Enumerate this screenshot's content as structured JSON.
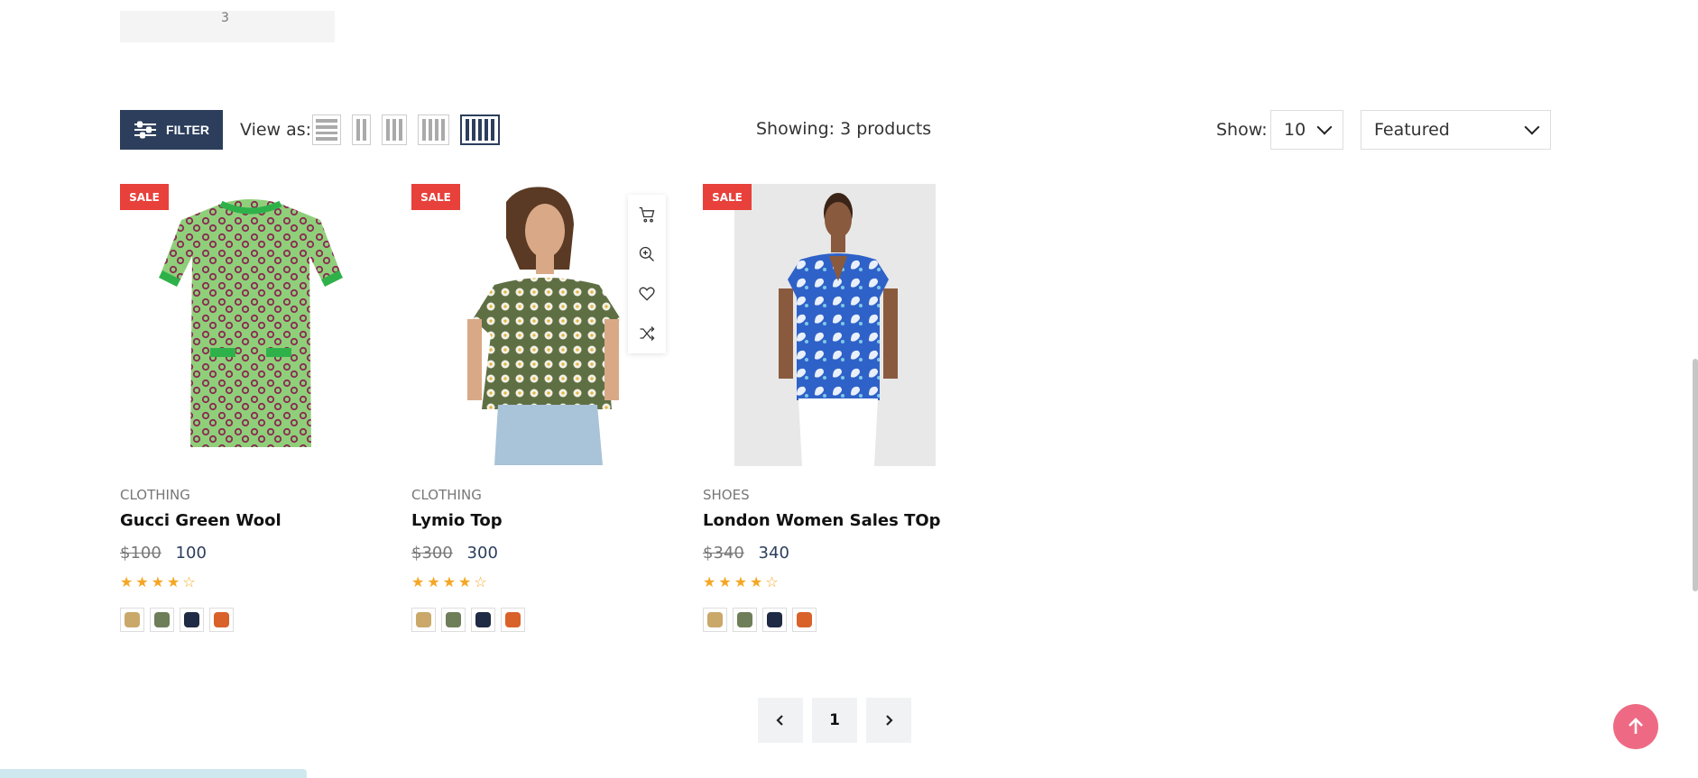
{
  "top_box": {
    "number": "3"
  },
  "toolbar": {
    "filter_label": "FILTER",
    "view_as_label": "View as:",
    "showing_text": "Showing: 3 products",
    "show_label": "Show:",
    "per_page_value": "10",
    "sort_value": "Featured",
    "active_view": "5-column"
  },
  "products": [
    {
      "badge": "SALE",
      "category": "CLOTHING",
      "title": "Gucci Green Wool",
      "old_price": "$100",
      "price": "100",
      "rating": 4,
      "stars": "★★★★☆",
      "swatches": [
        "#c9a86a",
        "#6e7e58",
        "#1f2a44",
        "#d9612a"
      ]
    },
    {
      "badge": "SALE",
      "category": "CLOTHING",
      "title": "Lymio Top",
      "old_price": "$300",
      "price": "300",
      "rating": 4,
      "stars": "★★★★☆",
      "swatches": [
        "#c9a86a",
        "#6e7e58",
        "#1f2a44",
        "#d9612a"
      ]
    },
    {
      "badge": "SALE",
      "category": "SHOES",
      "title": "London Women Sales TOp",
      "old_price": "$340",
      "price": "340",
      "rating": 4,
      "stars": "★★★★☆",
      "swatches": [
        "#c9a86a",
        "#6e7e58",
        "#1f2a44",
        "#d9612a"
      ]
    }
  ],
  "pagination": {
    "current": "1"
  },
  "colors": {
    "primary": "#2c3e5c",
    "sale": "#e8403a",
    "star": "#f5a623",
    "back_to_top": "#ee6a84"
  }
}
